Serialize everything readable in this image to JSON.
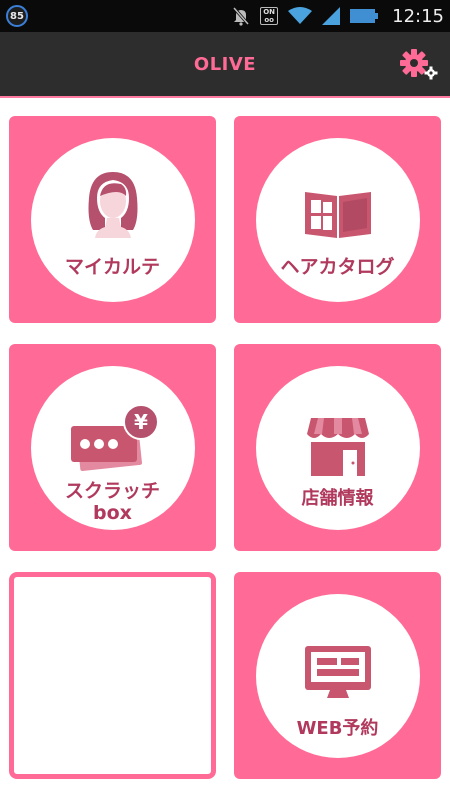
{
  "status_bar": {
    "badge": "85",
    "on_label": "ON",
    "time": "12:15"
  },
  "header": {
    "title": "OLIVE"
  },
  "tiles": [
    {
      "label": "マイカルテ"
    },
    {
      "label": "ヘアカタログ"
    },
    {
      "label_line1": "スクラッチ",
      "label_line2": "box",
      "yen": "¥"
    },
    {
      "label": "店舗情報"
    },
    {
      "label": "WEB予約"
    }
  ],
  "colors": {
    "accent": "#ff6b96",
    "label": "#b0395d",
    "header_bg": "#2d2d2d",
    "icon": "#c9566f"
  }
}
